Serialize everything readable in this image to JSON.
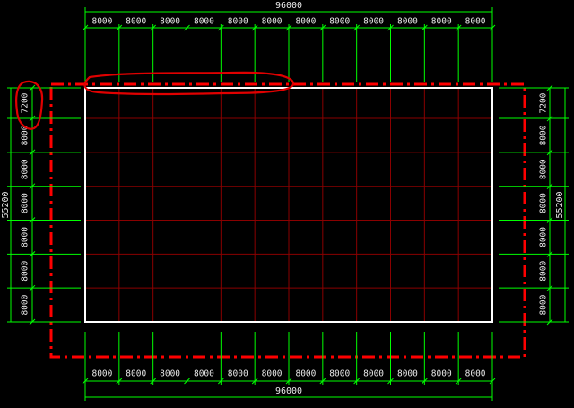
{
  "drawing": {
    "colors": {
      "background": "#000000",
      "dimension_lines": "#00ff00",
      "dimension_text": "#e8e8e8",
      "axis_grid": "#8a0000",
      "building_outline": "#ffffff",
      "boundary_dashdot": "#ff0000",
      "markup_circle": "#e00000"
    },
    "top_dimensions": {
      "segments": [
        "8000",
        "8000",
        "8000",
        "8000",
        "8000",
        "8000",
        "8000",
        "8000",
        "8000",
        "8000",
        "8000",
        "8000"
      ],
      "total": "96000"
    },
    "bottom_dimensions": {
      "segments": [
        "8000",
        "8000",
        "8000",
        "8000",
        "8000",
        "8000",
        "8000",
        "8000",
        "8000",
        "8000",
        "8000",
        "8000"
      ],
      "total": "96000"
    },
    "left_dimensions": {
      "segments": [
        "7200",
        "8000",
        "8000",
        "8000",
        "8000",
        "8000",
        "8000"
      ],
      "total": "55200"
    },
    "right_dimensions": {
      "segments": [
        "7200",
        "8000",
        "8000",
        "8000",
        "8000",
        "8000",
        "8000"
      ],
      "total": "55200"
    },
    "markups": [
      {
        "name": "markup-top-left-dimension-segments",
        "shape": "freehand-ellipse"
      },
      {
        "name": "markup-left-7200-label",
        "shape": "freehand-ellipse"
      }
    ]
  }
}
